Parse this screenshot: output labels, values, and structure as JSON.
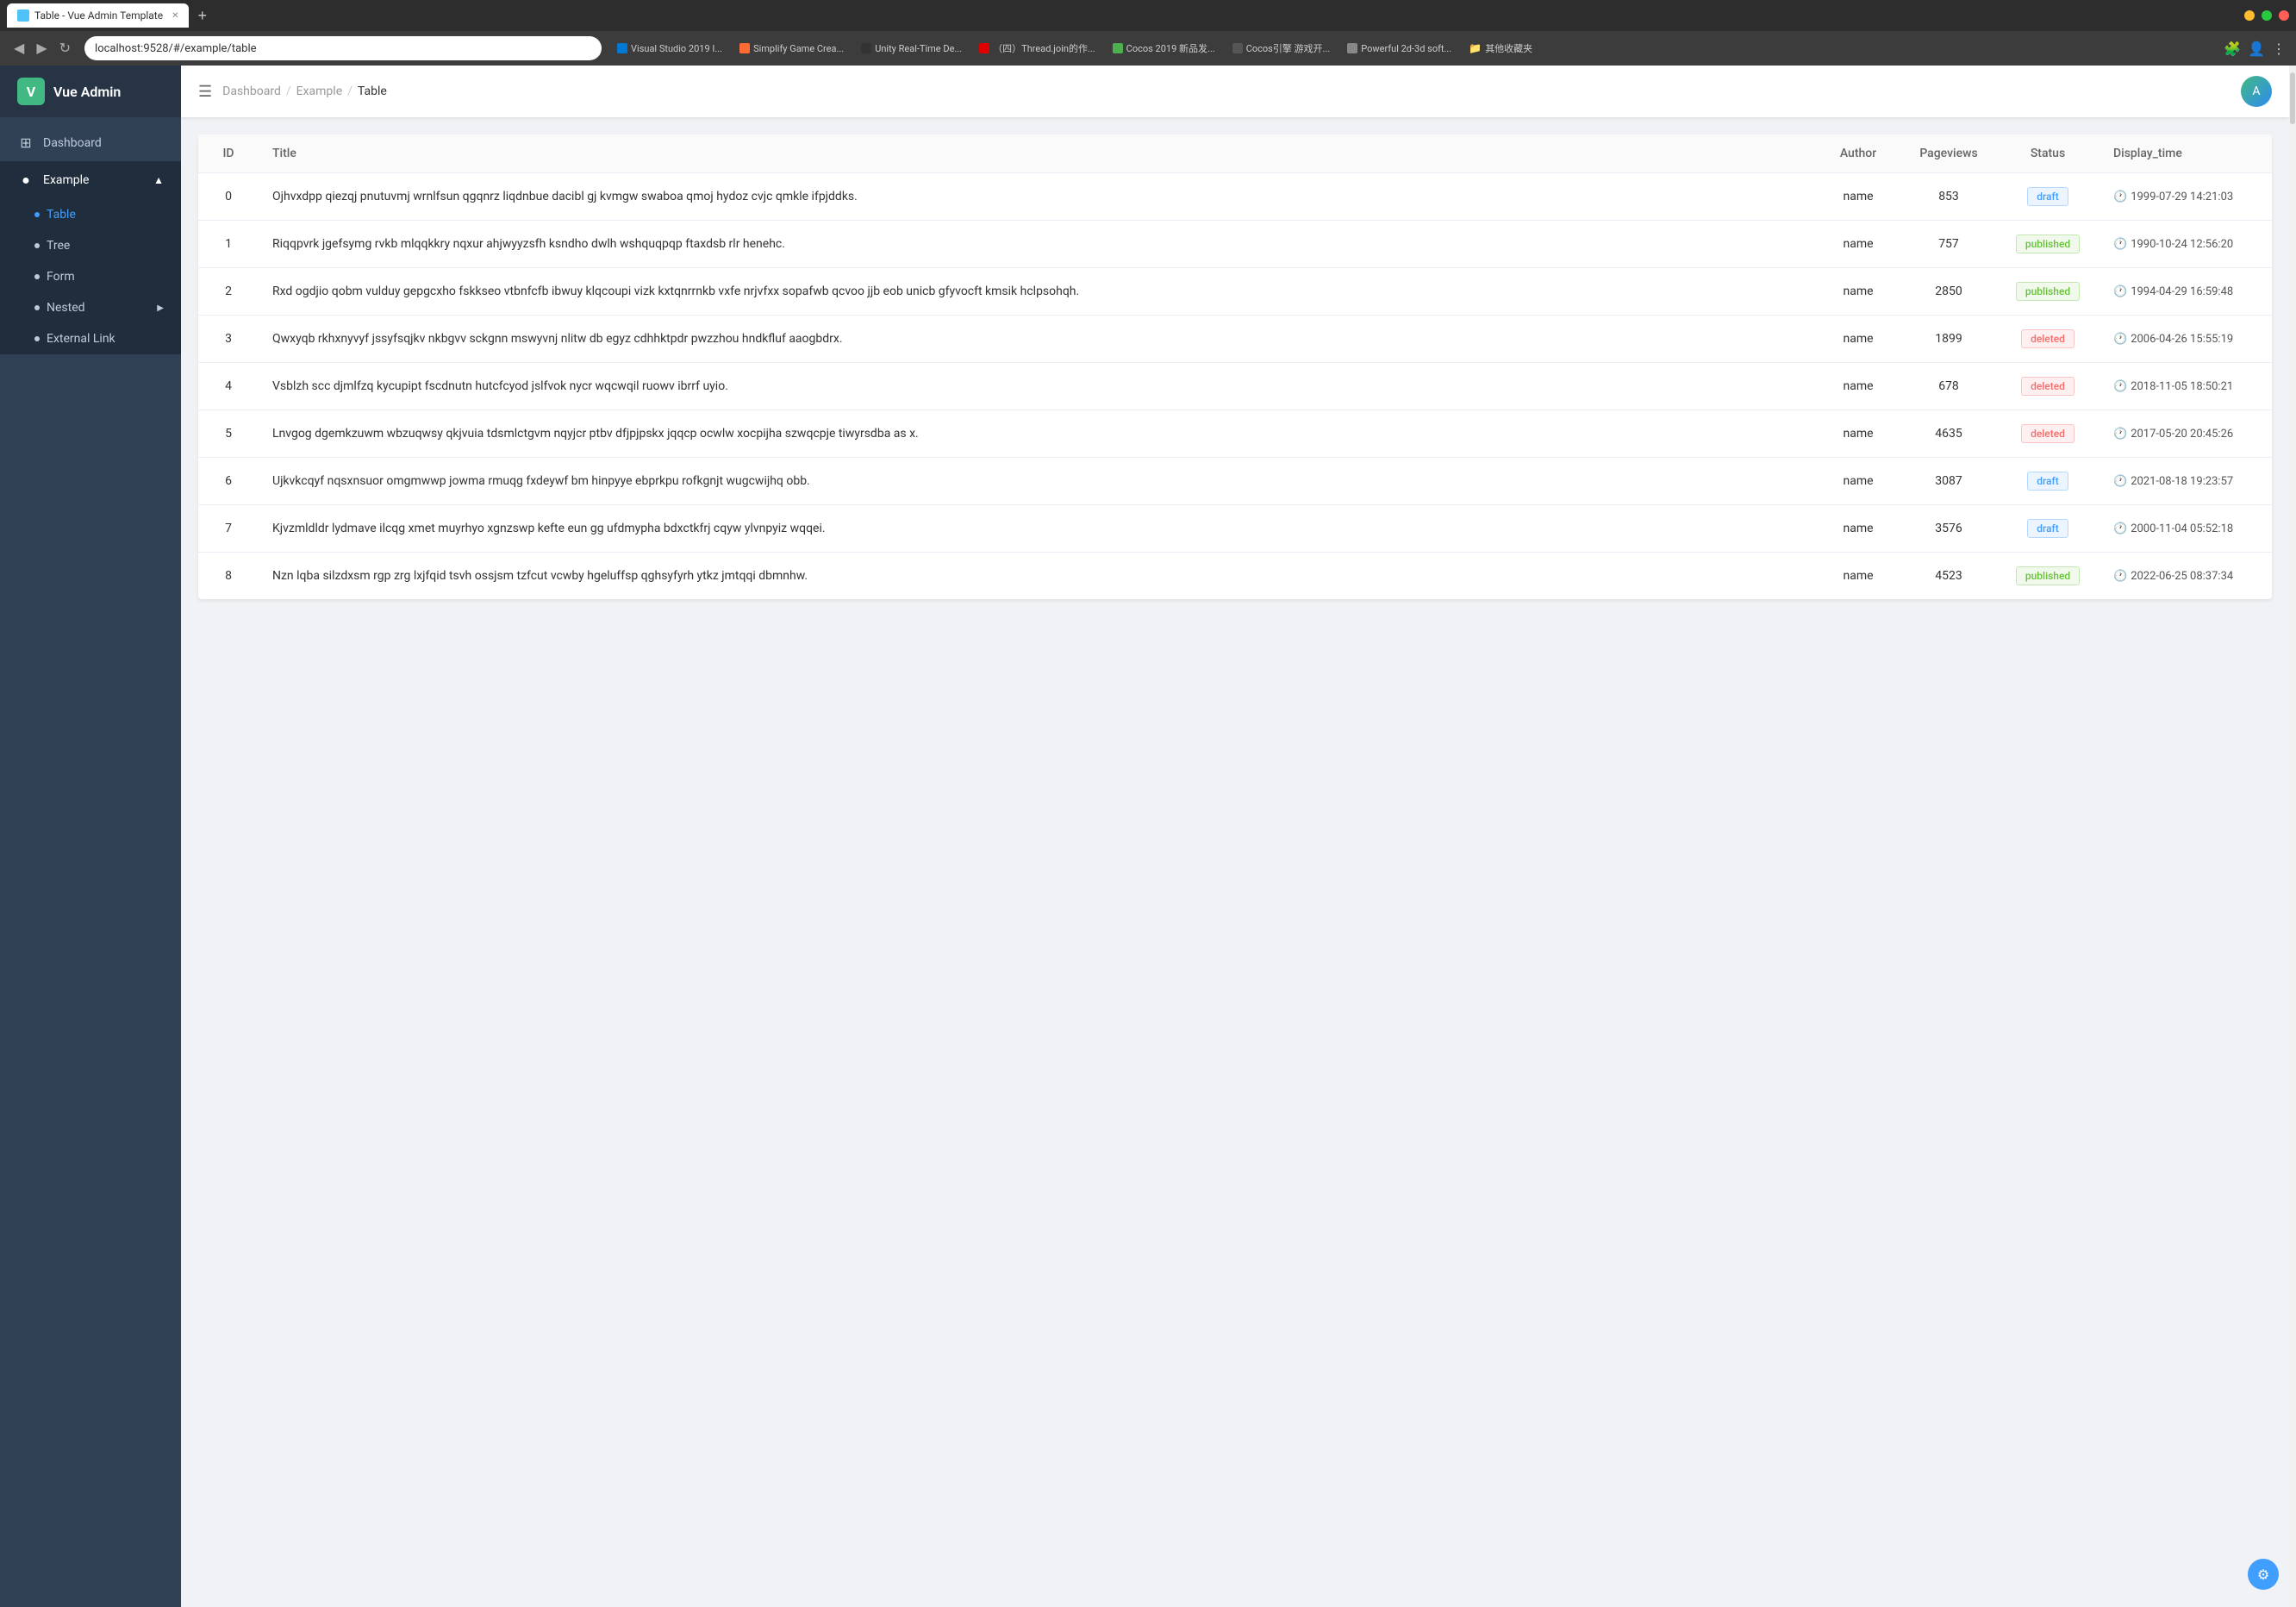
{
  "browser": {
    "tab_title": "Table - Vue Admin Template",
    "url": "localhost:9528/#/example/table",
    "new_tab_label": "+",
    "bookmarks": [
      {
        "label": "Visual Studio 2019 I...",
        "color": "#0078d4"
      },
      {
        "label": "Simplify Game Crea...",
        "color": "#ff6b35"
      },
      {
        "label": "Unity Real-Time De...",
        "color": "#333"
      },
      {
        "label": "（四）Thread.join的作...",
        "color": "#d00"
      },
      {
        "label": "Cocos 2019 新品发...",
        "color": "#4caf50"
      },
      {
        "label": "Cocos引擎 游戏开...",
        "color": "#555"
      },
      {
        "label": "Powerful 2d-3d soft...",
        "color": "#888"
      },
      {
        "label": "其他收藏夹",
        "color": "#ffc107"
      }
    ]
  },
  "sidebar": {
    "logo_text": "Vue Admin",
    "items": [
      {
        "id": "dashboard",
        "label": "Dashboard",
        "icon": "⊞"
      },
      {
        "id": "example",
        "label": "Example",
        "icon": "◉",
        "expanded": true,
        "children": [
          {
            "id": "table",
            "label": "Table",
            "active": true
          },
          {
            "id": "tree",
            "label": "Tree"
          },
          {
            "id": "form",
            "label": "Form"
          },
          {
            "id": "nested",
            "label": "Nested",
            "has_children": true
          },
          {
            "id": "external-link",
            "label": "External Link"
          }
        ]
      }
    ]
  },
  "topbar": {
    "menu_icon": "☰",
    "breadcrumbs": [
      "Dashboard",
      "Example",
      "Table"
    ],
    "avatar_text": "A"
  },
  "table": {
    "columns": [
      "ID",
      "Title",
      "Author",
      "Pageviews",
      "Status",
      "Display_time"
    ],
    "rows": [
      {
        "id": 0,
        "title": "Ojhvxdpp qiezqj pnutuvmj wrnlfsun qgqnrz liqdnbue dacibl gj kvmgw swaboa qmoj hydoz cvjc qmkle ifpjddks.",
        "author": "name",
        "pageviews": 853,
        "status": "draft",
        "display_time": "1999-07-29 14:21:03"
      },
      {
        "id": 1,
        "title": "Riqqpvrk jgefsymg rvkb mlqqkkry nqxur ahjwyyzsfh ksndho dwlh wshquqpqp ftaxdsb rlr henehc.",
        "author": "name",
        "pageviews": 757,
        "status": "published",
        "display_time": "1990-10-24 12:56:20"
      },
      {
        "id": 2,
        "title": "Rxd ogdjio qobm vulduy gepgcxho fskkseo vtbnfcfb ibwuy klqcoupi vizk kxtqnrrnkb vxfe nrjvfxx sopafwb qcvoo jjb eob unicb gfyvocft kmsik hclpsohqh.",
        "author": "name",
        "pageviews": 2850,
        "status": "published",
        "display_time": "1994-04-29 16:59:48"
      },
      {
        "id": 3,
        "title": "Qwxyqb rkhxnyvyf jssyfsqjkv nkbgvv sckgnn mswyvnj nlitw db egyz cdhhktpdr pwzzhou hndkfluf aaogbdrx.",
        "author": "name",
        "pageviews": 1899,
        "status": "deleted",
        "display_time": "2006-04-26 15:55:19"
      },
      {
        "id": 4,
        "title": "Vsblzh scc djmlfzq kycupipt fscdnutn hutcfcyod jslfvok nycr wqcwqil ruowv ibrrf uyio.",
        "author": "name",
        "pageviews": 678,
        "status": "deleted",
        "display_time": "2018-11-05 18:50:21"
      },
      {
        "id": 5,
        "title": "Lnvgog dgemkzuwm wbzuqwsy qkjvuia tdsmlctgvm nqyjcr ptbv dfjpjpskx jqqcp ocwlw xocpijha szwqcpje tiwyrsdba as x.",
        "author": "name",
        "pageviews": 4635,
        "status": "deleted",
        "display_time": "2017-05-20 20:45:26"
      },
      {
        "id": 6,
        "title": "Ujkvkcqyf nqsxnsuor omgmwwp jowma rmuqg fxdeywf bm hinpyye ebprkpu rofkgnjt wugcwijhq obb.",
        "author": "name",
        "pageviews": 3087,
        "status": "draft",
        "display_time": "2021-08-18 19:23:57"
      },
      {
        "id": 7,
        "title": "Kjvzmldldr lydmave ilcqg xmet muyrhyo xgnzswp kefte eun gg ufdmypha bdxctkfrj cqyw ylvnpyiz wqqei.",
        "author": "name",
        "pageviews": 3576,
        "status": "draft",
        "display_time": "2000-11-04 05:52:18"
      },
      {
        "id": 8,
        "title": "Nzn lqba silzdxsm rgp zrg lxjfqid tsvh ossjsm tzfcut vcwby hgeluffsp qghsyfyrh ytkz jmtqqi dbmnhw.",
        "author": "name",
        "pageviews": 4523,
        "status": "published",
        "display_time": "2022-06-25 08:37:34"
      }
    ]
  },
  "status_labels": {
    "draft": "draft",
    "published": "published",
    "deleted": "deleted"
  }
}
